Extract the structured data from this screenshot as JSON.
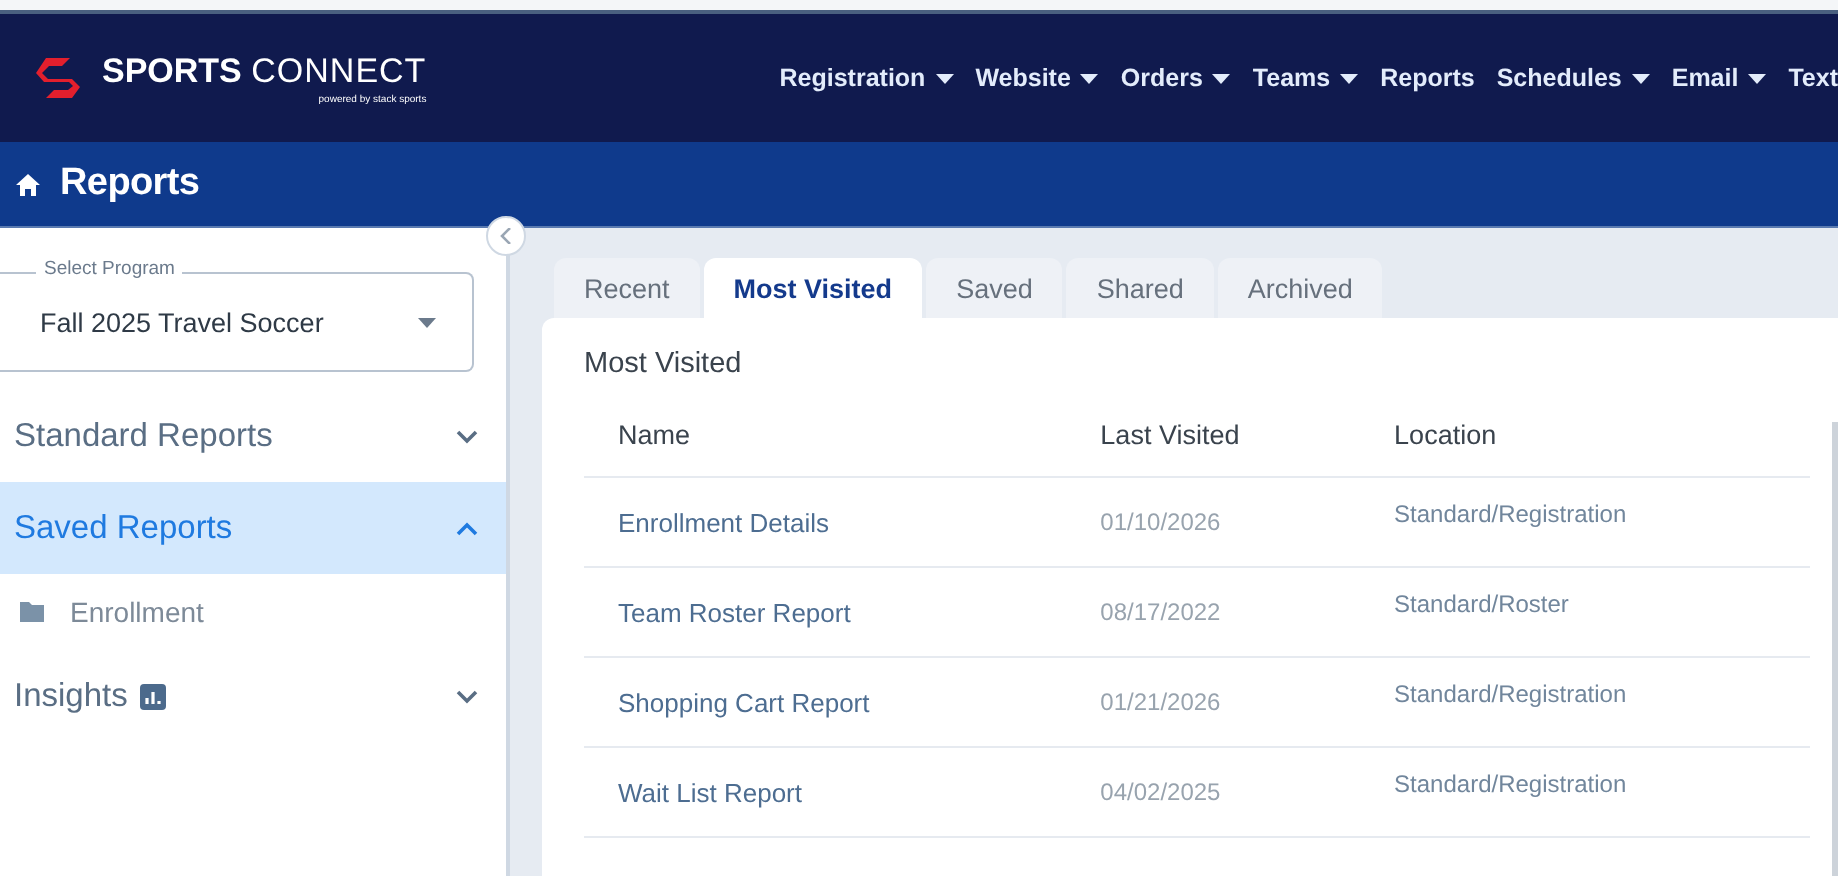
{
  "brand": {
    "name": "SPORTS",
    "name_light": "CONNECT",
    "tagline": "powered by stack sports"
  },
  "nav": [
    {
      "label": "Registration",
      "dropdown": true
    },
    {
      "label": "Website",
      "dropdown": true
    },
    {
      "label": "Orders",
      "dropdown": true
    },
    {
      "label": "Teams",
      "dropdown": true
    },
    {
      "label": "Reports",
      "dropdown": false
    },
    {
      "label": "Schedules",
      "dropdown": true
    },
    {
      "label": "Email",
      "dropdown": true
    },
    {
      "label": "Text",
      "dropdown": false
    }
  ],
  "page_title": "Reports",
  "program_select": {
    "label": "Select Program",
    "value": "Fall 2025 Travel Soccer"
  },
  "sidebar": [
    {
      "label": "Standard Reports",
      "expanded": false,
      "selected": false,
      "badge": false
    },
    {
      "label": "Saved Reports",
      "expanded": true,
      "selected": true,
      "badge": false,
      "children": [
        {
          "label": "Enrollment"
        }
      ]
    },
    {
      "label": "Insights",
      "expanded": false,
      "selected": false,
      "badge": true
    }
  ],
  "tabs": [
    {
      "label": "Recent",
      "selected": false
    },
    {
      "label": "Most Visited",
      "selected": true
    },
    {
      "label": "Saved",
      "selected": false
    },
    {
      "label": "Shared",
      "selected": false
    },
    {
      "label": "Archived",
      "selected": false
    }
  ],
  "section_title": "Most Visited",
  "table": {
    "columns": [
      "Name",
      "Last Visited",
      "Location"
    ],
    "rows": [
      [
        "Enrollment Details",
        "01/10/2026",
        "Standard/Registration"
      ],
      [
        "Team Roster Report",
        "08/17/2022",
        "Standard/Roster"
      ],
      [
        "Shopping Cart Report",
        "01/21/2026",
        "Standard/Registration"
      ],
      [
        "Wait List Report",
        "04/02/2025",
        "Standard/Registration"
      ]
    ]
  }
}
